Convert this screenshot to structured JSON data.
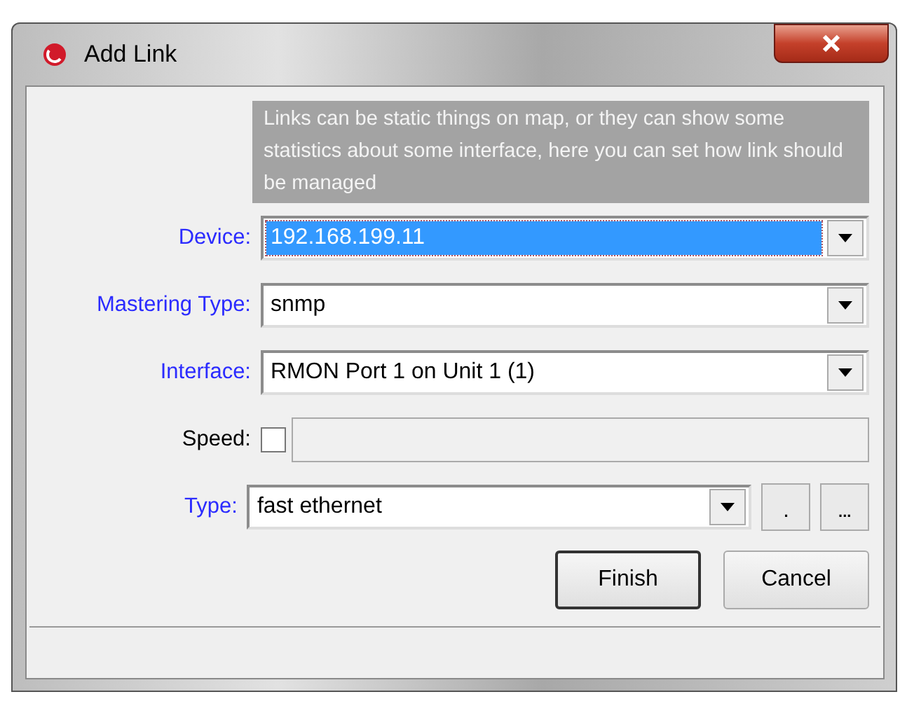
{
  "window": {
    "title": "Add Link"
  },
  "description": "Links can be static things on map, or they can show some statistics about some interface, here you can set how link should be managed",
  "fields": [
    {
      "kind": "combo",
      "label": "Device:",
      "color": "#2b2bff",
      "value": "192.168.199.11",
      "selected": true
    },
    {
      "kind": "combo",
      "label": "Mastering Type:",
      "color": "#2b2bff",
      "value": "snmp",
      "selected": false
    },
    {
      "kind": "combo",
      "label": "Interface:",
      "color": "#2b2bff",
      "value": "RMON Port  1 on Unit 1 (1)",
      "selected": false
    },
    {
      "kind": "check",
      "label": "Speed:",
      "color": "#000000",
      "checked": false,
      "disabled": true
    },
    {
      "kind": "combo-buttons",
      "label": "Type:",
      "color": "#2b2bff",
      "value": "fast ethernet",
      "selected": false,
      "buttons": [
        ".",
        "..."
      ]
    }
  ],
  "buttons": [
    {
      "label": "Finish",
      "default": true
    },
    {
      "label": "Cancel",
      "default": false
    }
  ]
}
